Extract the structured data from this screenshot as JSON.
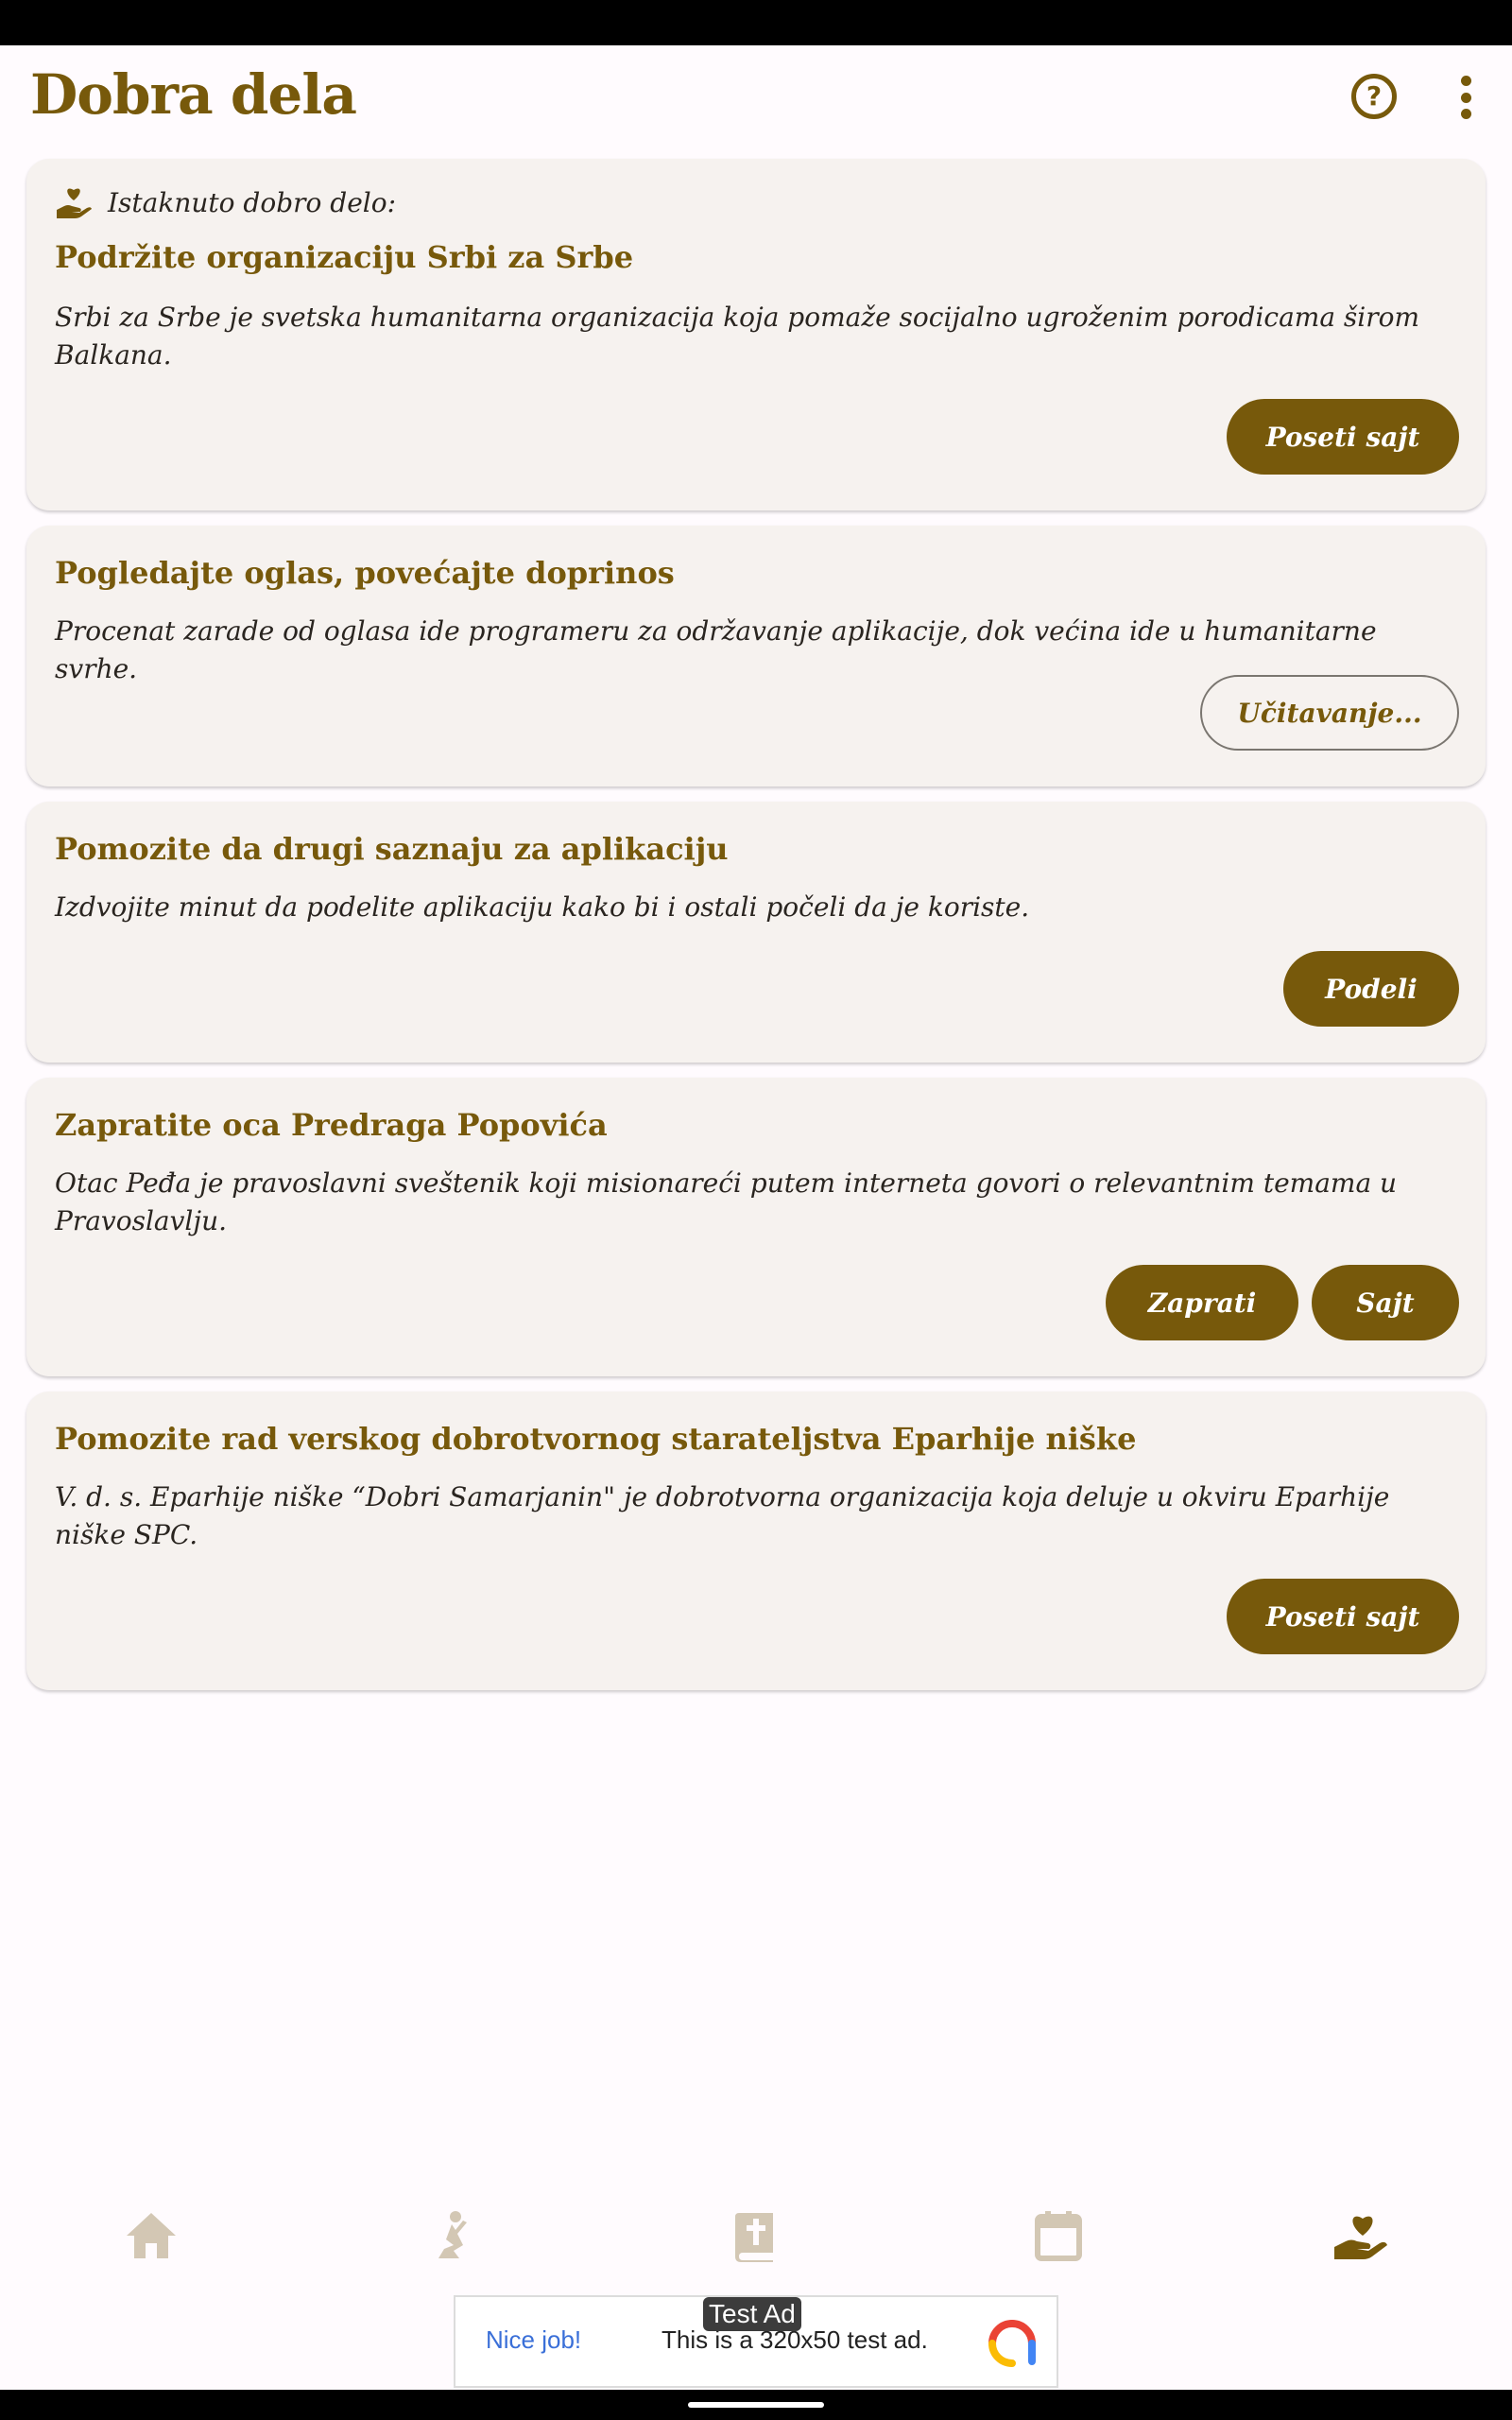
{
  "app": {
    "title": "Dobra dela"
  },
  "header": {
    "help_icon": "help-circle-icon",
    "menu_icon": "more-vert-icon"
  },
  "featured_label": "Istaknuto dobro delo:",
  "cards": [
    {
      "title": "Podržite organizaciju Srbi za Srbe",
      "description": "Srbi za Srbe je svetska humanitarna organizacija koja pomaže socijalno ugroženim porodicama širom Balkana.",
      "buttons": [
        {
          "label": "Poseti sajt",
          "style": "filled"
        }
      ]
    },
    {
      "title": "Pogledajte oglas, povećajte doprinos",
      "description": "Procenat zarade od oglasa ide programeru za održavanje aplikacije, dok većina ide u humanitarne svrhe.",
      "buttons": [
        {
          "label": "Učitavanje...",
          "style": "outline"
        }
      ]
    },
    {
      "title": "Pomozite da drugi saznaju za aplikaciju",
      "description": "Izdvojite minut da podelite aplikaciju kako bi i ostali počeli da je koriste.",
      "buttons": [
        {
          "label": "Podeli",
          "style": "filled"
        }
      ]
    },
    {
      "title": "Zapratite oca Predraga Popovića",
      "description": "Otac Peđa je pravoslavni sveštenik koji misionareći putem interneta govori o relevantnim temama u Pravoslavlju.",
      "buttons": [
        {
          "label": "Zaprati",
          "style": "filled"
        },
        {
          "label": "Sajt",
          "style": "filled"
        }
      ]
    },
    {
      "title": "Pomozite rad verskog dobrotvornog starateljstva Eparhije niške",
      "description": "V. d. s. Eparhije niške “Dobri Samarjanin\" je dobrotvorna organizacija koja deluje u okviru Eparhije niške SPC.",
      "buttons": [
        {
          "label": "Poseti sajt",
          "style": "filled"
        }
      ]
    }
  ],
  "bottom_nav": [
    {
      "icon": "home-icon",
      "active": false
    },
    {
      "icon": "praying-icon",
      "active": false
    },
    {
      "icon": "prayer-book-icon",
      "active": false
    },
    {
      "icon": "calendar-icon",
      "active": false
    },
    {
      "icon": "charity-hand-heart-icon",
      "active": true
    }
  ],
  "ad": {
    "tag": "Test Ad",
    "nice": "Nice job!",
    "text": "This is a 320x50 test ad.",
    "logo_icon": "ad-network-logo-icon"
  },
  "colors": {
    "accent": "#77590b",
    "card_bg": "#f6f2ef",
    "nav_inactive": "#d3c7b4",
    "page_bg": "#fffbfe"
  }
}
